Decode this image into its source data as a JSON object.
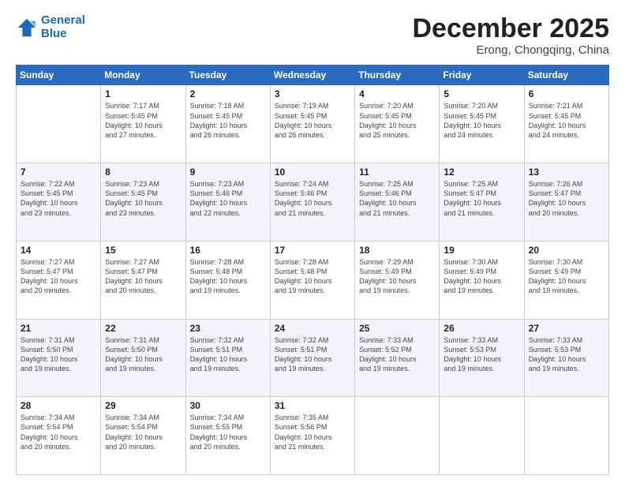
{
  "header": {
    "logo_line1": "General",
    "logo_line2": "Blue",
    "month": "December 2025",
    "location": "Erong, Chongqing, China"
  },
  "weekdays": [
    "Sunday",
    "Monday",
    "Tuesday",
    "Wednesday",
    "Thursday",
    "Friday",
    "Saturday"
  ],
  "weeks": [
    [
      {
        "day": "",
        "info": ""
      },
      {
        "day": "1",
        "info": "Sunrise: 7:17 AM\nSunset: 5:45 PM\nDaylight: 10 hours\nand 27 minutes."
      },
      {
        "day": "2",
        "info": "Sunrise: 7:18 AM\nSunset: 5:45 PM\nDaylight: 10 hours\nand 26 minutes."
      },
      {
        "day": "3",
        "info": "Sunrise: 7:19 AM\nSunset: 5:45 PM\nDaylight: 10 hours\nand 26 minutes."
      },
      {
        "day": "4",
        "info": "Sunrise: 7:20 AM\nSunset: 5:45 PM\nDaylight: 10 hours\nand 25 minutes."
      },
      {
        "day": "5",
        "info": "Sunrise: 7:20 AM\nSunset: 5:45 PM\nDaylight: 10 hours\nand 24 minutes."
      },
      {
        "day": "6",
        "info": "Sunrise: 7:21 AM\nSunset: 5:45 PM\nDaylight: 10 hours\nand 24 minutes."
      }
    ],
    [
      {
        "day": "7",
        "info": "Sunrise: 7:22 AM\nSunset: 5:45 PM\nDaylight: 10 hours\nand 23 minutes."
      },
      {
        "day": "8",
        "info": "Sunrise: 7:23 AM\nSunset: 5:45 PM\nDaylight: 10 hours\nand 23 minutes."
      },
      {
        "day": "9",
        "info": "Sunrise: 7:23 AM\nSunset: 5:46 PM\nDaylight: 10 hours\nand 22 minutes."
      },
      {
        "day": "10",
        "info": "Sunrise: 7:24 AM\nSunset: 5:46 PM\nDaylight: 10 hours\nand 21 minutes."
      },
      {
        "day": "11",
        "info": "Sunrise: 7:25 AM\nSunset: 5:46 PM\nDaylight: 10 hours\nand 21 minutes."
      },
      {
        "day": "12",
        "info": "Sunrise: 7:25 AM\nSunset: 5:47 PM\nDaylight: 10 hours\nand 21 minutes."
      },
      {
        "day": "13",
        "info": "Sunrise: 7:26 AM\nSunset: 5:47 PM\nDaylight: 10 hours\nand 20 minutes."
      }
    ],
    [
      {
        "day": "14",
        "info": "Sunrise: 7:27 AM\nSunset: 5:47 PM\nDaylight: 10 hours\nand 20 minutes."
      },
      {
        "day": "15",
        "info": "Sunrise: 7:27 AM\nSunset: 5:47 PM\nDaylight: 10 hours\nand 20 minutes."
      },
      {
        "day": "16",
        "info": "Sunrise: 7:28 AM\nSunset: 5:48 PM\nDaylight: 10 hours\nand 19 minutes."
      },
      {
        "day": "17",
        "info": "Sunrise: 7:28 AM\nSunset: 5:48 PM\nDaylight: 10 hours\nand 19 minutes."
      },
      {
        "day": "18",
        "info": "Sunrise: 7:29 AM\nSunset: 5:49 PM\nDaylight: 10 hours\nand 19 minutes."
      },
      {
        "day": "19",
        "info": "Sunrise: 7:30 AM\nSunset: 5:49 PM\nDaylight: 10 hours\nand 19 minutes."
      },
      {
        "day": "20",
        "info": "Sunrise: 7:30 AM\nSunset: 5:49 PM\nDaylight: 10 hours\nand 19 minutes."
      }
    ],
    [
      {
        "day": "21",
        "info": "Sunrise: 7:31 AM\nSunset: 5:50 PM\nDaylight: 10 hours\nand 19 minutes."
      },
      {
        "day": "22",
        "info": "Sunrise: 7:31 AM\nSunset: 5:50 PM\nDaylight: 10 hours\nand 19 minutes."
      },
      {
        "day": "23",
        "info": "Sunrise: 7:32 AM\nSunset: 5:51 PM\nDaylight: 10 hours\nand 19 minutes."
      },
      {
        "day": "24",
        "info": "Sunrise: 7:32 AM\nSunset: 5:51 PM\nDaylight: 10 hours\nand 19 minutes."
      },
      {
        "day": "25",
        "info": "Sunrise: 7:33 AM\nSunset: 5:52 PM\nDaylight: 10 hours\nand 19 minutes."
      },
      {
        "day": "26",
        "info": "Sunrise: 7:33 AM\nSunset: 5:53 PM\nDaylight: 10 hours\nand 19 minutes."
      },
      {
        "day": "27",
        "info": "Sunrise: 7:33 AM\nSunset: 5:53 PM\nDaylight: 10 hours\nand 19 minutes."
      }
    ],
    [
      {
        "day": "28",
        "info": "Sunrise: 7:34 AM\nSunset: 5:54 PM\nDaylight: 10 hours\nand 20 minutes."
      },
      {
        "day": "29",
        "info": "Sunrise: 7:34 AM\nSunset: 5:54 PM\nDaylight: 10 hours\nand 20 minutes."
      },
      {
        "day": "30",
        "info": "Sunrise: 7:34 AM\nSunset: 5:55 PM\nDaylight: 10 hours\nand 20 minutes."
      },
      {
        "day": "31",
        "info": "Sunrise: 7:35 AM\nSunset: 5:56 PM\nDaylight: 10 hours\nand 21 minutes."
      },
      {
        "day": "",
        "info": ""
      },
      {
        "day": "",
        "info": ""
      },
      {
        "day": "",
        "info": ""
      }
    ]
  ]
}
